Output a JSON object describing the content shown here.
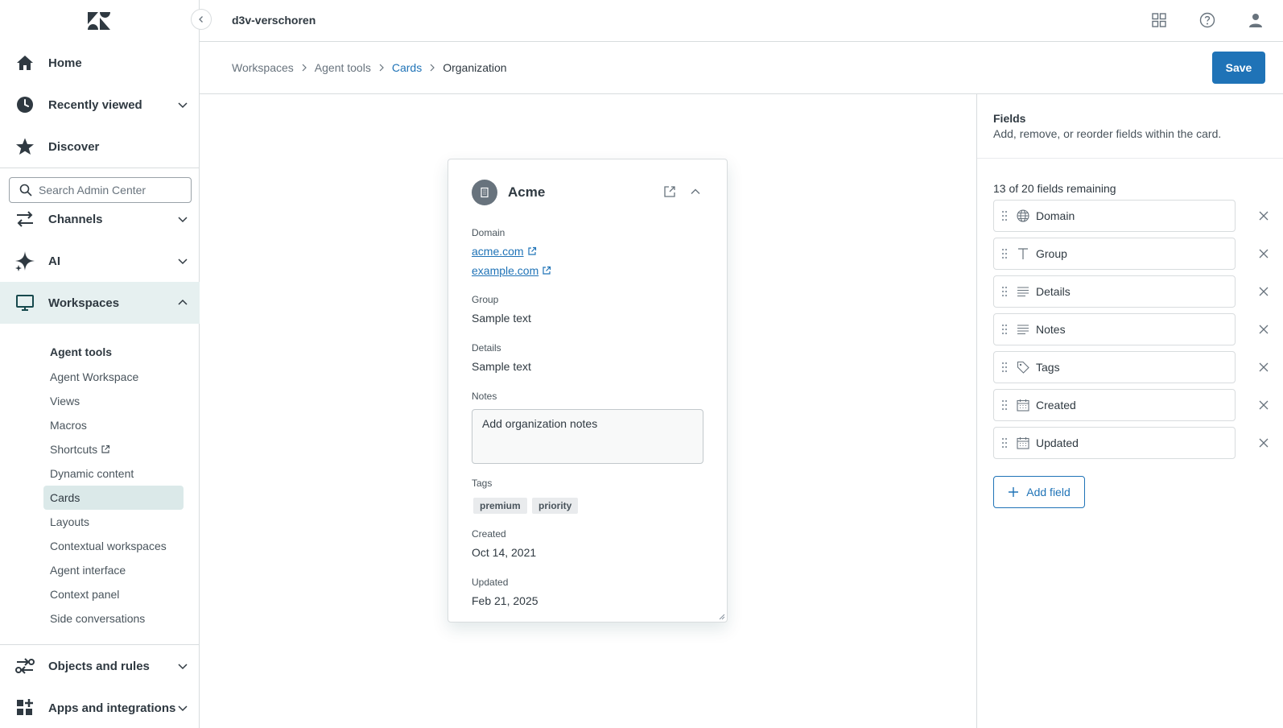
{
  "app": {
    "account_name": "d3v-verschoren"
  },
  "sidebar": {
    "nav_top": [
      {
        "label": "Home",
        "icon": "home-icon"
      },
      {
        "label": "Recently viewed",
        "icon": "clock-icon"
      },
      {
        "label": "Discover",
        "icon": "star-icon"
      }
    ],
    "search_placeholder": "Search Admin Center",
    "nav_main": [
      {
        "label": "Channels",
        "icon": "channels-icon"
      },
      {
        "label": "AI",
        "icon": "sparkle-icon"
      },
      {
        "label": "Workspaces",
        "icon": "monitor-icon"
      }
    ],
    "sub_heading": "Agent tools",
    "sub_items": [
      "Agent Workspace",
      "Views",
      "Macros",
      "Shortcuts",
      "Dynamic content",
      "Cards",
      "Layouts",
      "Contextual workspaces",
      "Agent interface",
      "Context panel",
      "Side conversations"
    ],
    "selected_sub_item": "Cards",
    "nav_bottom": [
      {
        "label": "Objects and rules",
        "icon": "objects-icon"
      },
      {
        "label": "Apps and integrations",
        "icon": "apps-icon"
      }
    ]
  },
  "breadcrumb": {
    "items": [
      "Workspaces",
      "Agent tools",
      "Cards",
      "Organization"
    ]
  },
  "toolbar": {
    "save_label": "Save"
  },
  "card": {
    "name": "Acme",
    "domain_label": "Domain",
    "domains": [
      "acme.com",
      "example.com"
    ],
    "group_label": "Group",
    "group_value": "Sample text",
    "details_label": "Details",
    "details_value": "Sample text",
    "notes_label": "Notes",
    "notes_placeholder": "Add organization notes",
    "tags_label": "Tags",
    "tags": [
      "premium",
      "priority"
    ],
    "created_label": "Created",
    "created_value": "Oct 14, 2021",
    "updated_label": "Updated",
    "updated_value": "Feb 21, 2025"
  },
  "fields_panel": {
    "title": "Fields",
    "description": "Add, remove, or reorder fields within the card.",
    "remaining": "13 of 20 fields remaining",
    "fields": [
      {
        "name": "Domain",
        "icon": "globe-icon"
      },
      {
        "name": "Group",
        "icon": "text-icon"
      },
      {
        "name": "Details",
        "icon": "lines-icon"
      },
      {
        "name": "Notes",
        "icon": "lines-icon"
      },
      {
        "name": "Tags",
        "icon": "tag-icon"
      },
      {
        "name": "Created",
        "icon": "calendar-icon"
      },
      {
        "name": "Updated",
        "icon": "calendar-icon"
      }
    ],
    "add_label": "Add field"
  },
  "colors": {
    "accent": "#1f73b7",
    "active_nav_bg": "#e6f0f0",
    "selected_sub_bg": "#dbe9e9",
    "text": "#2f3941"
  }
}
